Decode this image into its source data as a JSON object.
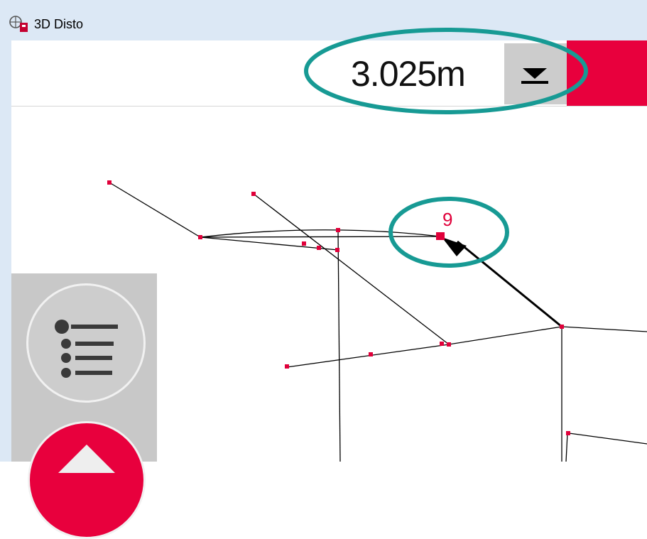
{
  "window": {
    "title": "3D Disto",
    "app_icon": "3d-disto-app-icon"
  },
  "toolbar": {
    "distance": "3.025m",
    "dropdown_icon": "triangle-down-with-bar-icon"
  },
  "canvas": {
    "point_label": "9"
  },
  "side_panel": {
    "list_icon": "bulleted-list-icon",
    "up_icon": "up-arrow-icon"
  },
  "colors": {
    "accent_red": "#e8003d",
    "annotation_teal": "#179a94",
    "panel_gray": "#c8c8c8",
    "titlebar_blue": "#dce8f5"
  }
}
